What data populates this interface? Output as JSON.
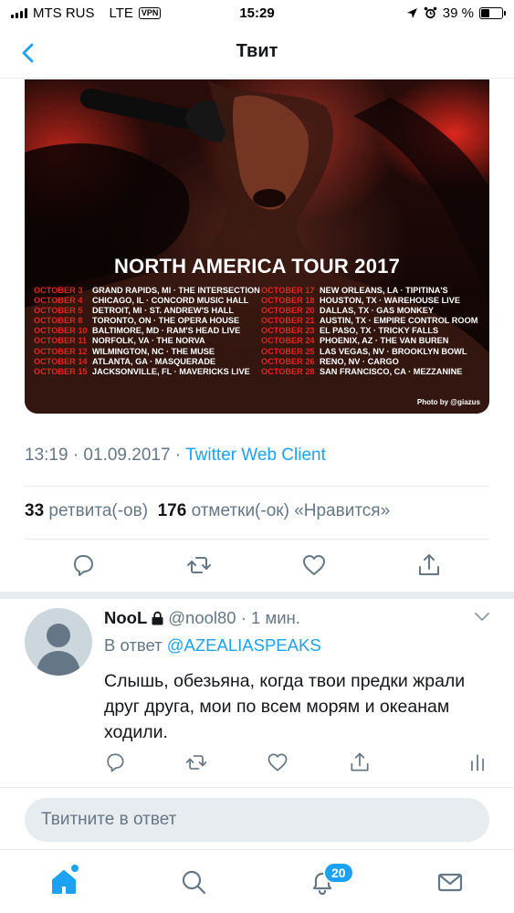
{
  "status_bar": {
    "carrier": "MTS RUS",
    "network": "LTE",
    "vpn": "VPN",
    "time": "15:29",
    "battery": "39 %",
    "battery_level": 0.39
  },
  "header": {
    "title": "Твит",
    "back_icon": "chevron-left-icon"
  },
  "media": {
    "tour_title": "NORTH AMERICA TOUR 2017",
    "credit": "Photo by @giazus",
    "dates_left": [
      {
        "date": "OCTOBER 3",
        "venue": "GRAND RAPIDS, MI  ·  THE INTERSECTION"
      },
      {
        "date": "OCTOBER 4",
        "venue": "CHICAGO, IL  ·  CONCORD MUSIC HALL"
      },
      {
        "date": "OCTOBER 5",
        "venue": "DETROIT, MI  ·  ST. ANDREW'S HALL"
      },
      {
        "date": "OCTOBER 8",
        "venue": "TORONTO, ON  ·  THE OPERA HOUSE"
      },
      {
        "date": "OCTOBER 10",
        "venue": "BALTIMORE, MD  ·  RAM'S HEAD LIVE"
      },
      {
        "date": "OCTOBER 11",
        "venue": "NORFOLK, VA  ·  THE NORVA"
      },
      {
        "date": "OCTOBER 12",
        "venue": "WILMINGTON, NC  ·  THE MUSE"
      },
      {
        "date": "OCTOBER 14",
        "venue": "ATLANTA, GA  ·  MASQUERADE"
      },
      {
        "date": "OCTOBER 15",
        "venue": "JACKSONVILLE, FL  ·  MAVERICKS LIVE"
      }
    ],
    "dates_right": [
      {
        "date": "OCTOBER 17",
        "venue": "NEW ORLEANS, LA  ·  TIPITINA'S"
      },
      {
        "date": "OCTOBER 18",
        "venue": "HOUSTON, TX  ·  WAREHOUSE LIVE"
      },
      {
        "date": "OCTOBER 20",
        "venue": "DALLAS, TX  ·  GAS MONKEY"
      },
      {
        "date": "OCTOBER 21",
        "venue": "AUSTIN, TX  ·  EMPIRE CONTROL ROOM"
      },
      {
        "date": "OCTOBER 23",
        "venue": "EL PASO, TX  ·  TRICKY FALLS"
      },
      {
        "date": "OCTOBER 24",
        "venue": "PHOENIX, AZ  ·  THE VAN BUREN"
      },
      {
        "date": "OCTOBER 25",
        "venue": "LAS VEGAS, NV  ·  BROOKLYN BOWL"
      },
      {
        "date": "OCTOBER 26",
        "venue": "RENO, NV  ·  CARGO"
      },
      {
        "date": "OCTOBER 28",
        "venue": "SAN FRANCISCO, CA  ·  MEZZANINE"
      }
    ]
  },
  "tweet_meta": {
    "timestamp": "13:19 · 01.09.2017 · ",
    "source": "Twitter Web Client"
  },
  "stats": {
    "retweets_count": "33",
    "retweets_label": " ретвита(-ов)",
    "likes_count": "176",
    "likes_label": " отметки(-ок) «Нравится»"
  },
  "actions": {
    "reply_icon": "reply-icon",
    "retweet_icon": "retweet-icon",
    "like_icon": "heart-icon",
    "share_icon": "share-icon"
  },
  "reply": {
    "name": "NooL",
    "handle": "@nool80 · 1 мин.",
    "reply_to_label": "В ответ ",
    "reply_to_user": "@AZEALIASPEAKS",
    "text": "Слышь, обезьяна, когда твои предки жрали друг друга, мои по всем морям и океанам ходили."
  },
  "composer": {
    "placeholder": "Твитните в ответ"
  },
  "tabbar": {
    "notifications_badge": "20"
  },
  "colors": {
    "accent": "#1da1f2",
    "secondary_text": "#657786",
    "divider": "#e6ecf0"
  }
}
